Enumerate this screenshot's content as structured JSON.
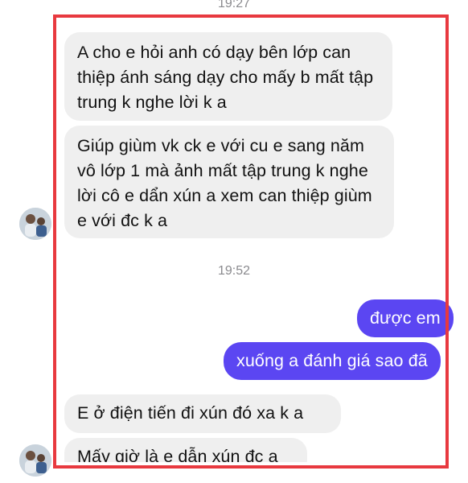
{
  "timestamps": {
    "top": "19:27",
    "middle": "19:52"
  },
  "messages": {
    "in_1": "A cho e hỏi anh có dạy bên lớp can thiệp ánh sáng dạy cho mấy b mất tập trung k nghe lời k a",
    "in_2": "Giúp giùm vk ck e với cu e sang năm vô lớp 1 mà ảnh mất tập trung k nghe lời cô e dẩn xún a xem can thiệp giùm e với đc k a",
    "out_1": "được em",
    "out_2": "xuống a đánh giá sao đã",
    "in_3": "E ở  điện tiến đi xún đó xa k a",
    "in_4": "Mấy giờ là e dẫn xún đc a"
  },
  "colors": {
    "incoming_bubble": "#efefef",
    "outgoing_bubble": "#5b46f2",
    "highlight_frame": "#e8393f"
  }
}
